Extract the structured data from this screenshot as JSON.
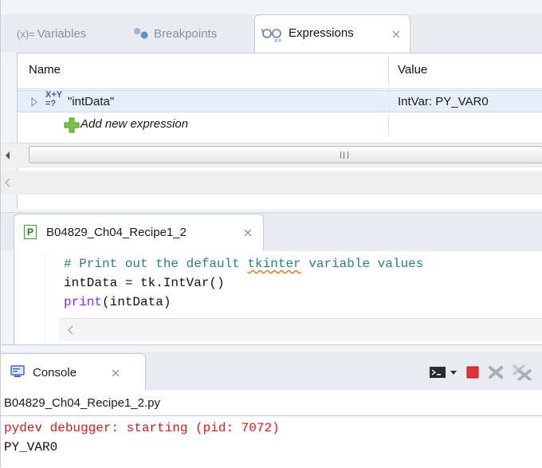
{
  "debug_view": {
    "tabs": [
      {
        "label": "Variables",
        "prefix": "(x)="
      },
      {
        "label": "Breakpoints"
      },
      {
        "label": "Expressions",
        "active": true
      }
    ],
    "columns": {
      "name": "Name",
      "value": "Value"
    },
    "rows": [
      {
        "icon_text_top": "X+Y",
        "icon_text_bottom": "=?",
        "name": "\"intData\"",
        "value": "IntVar: PY_VAR0"
      }
    ],
    "add_expression_label": "Add new expression",
    "scroll_grip": "III"
  },
  "editor": {
    "tab_label": "B04829_Ch04_Recipe1_2",
    "file_icon_letter": "P",
    "code_lines": {
      "line1_pre": "# Print out the default ",
      "line1_squiggle": "tkinter",
      "line1_post": " variable values",
      "line2": "intData = tk.IntVar()",
      "line3_kw": "print",
      "line3_rest": "(intData)"
    }
  },
  "console": {
    "tab_label": "Console",
    "path": "B04829_Ch04_Recipe1_2.py",
    "output": [
      "pydev debugger: starting (pid: 7072)",
      "PY_VAR0"
    ]
  },
  "colors": {
    "accent_blue": "#3a5aa8",
    "error_red": "#d21c1c",
    "comment_teal": "#2a7e7e",
    "keyword_purple": "#8a2bd6"
  }
}
